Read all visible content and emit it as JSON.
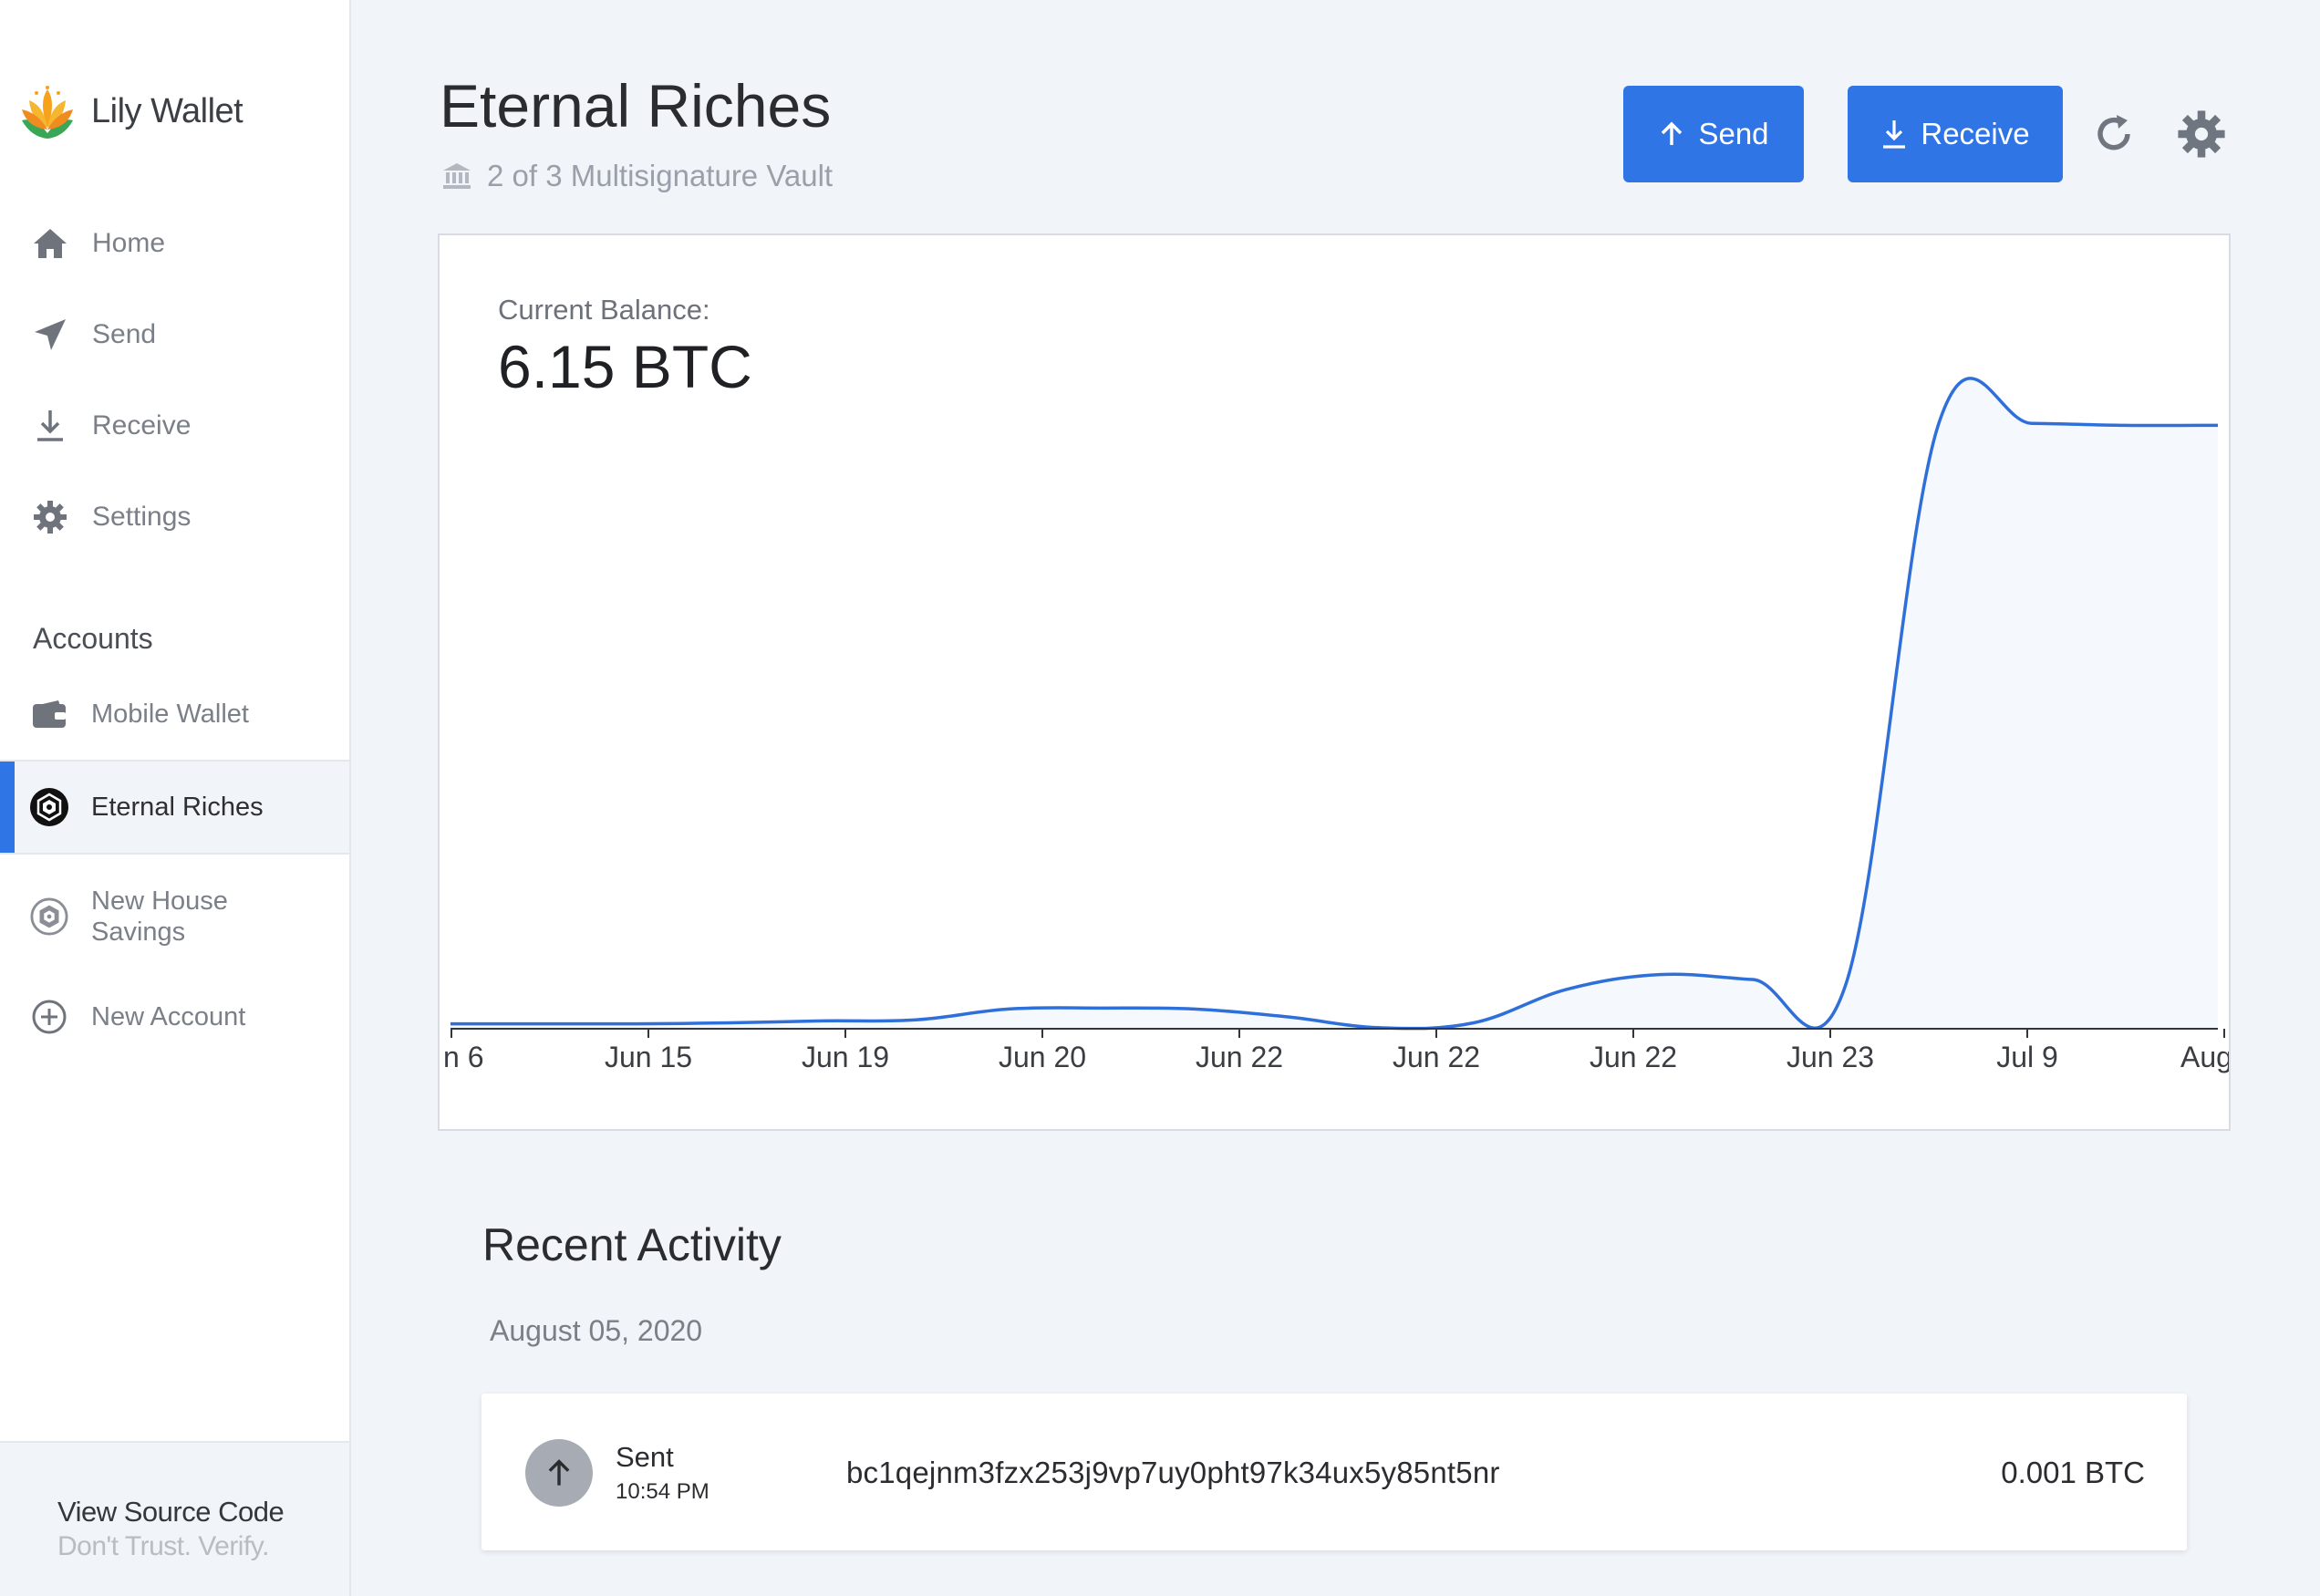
{
  "app": {
    "name": "Lily Wallet"
  },
  "colors": {
    "accent": "#2f75e6",
    "line": "#2f6fd9",
    "sidebar_bg": "#ffffff",
    "main_bg": "#f1f4f8"
  },
  "nav": [
    {
      "label": "Home",
      "icon": "home-icon"
    },
    {
      "label": "Send",
      "icon": "paper-plane-icon"
    },
    {
      "label": "Receive",
      "icon": "download-icon"
    },
    {
      "label": "Settings",
      "icon": "gear-icon"
    }
  ],
  "accounts": {
    "heading": "Accounts",
    "items": [
      {
        "label": "Mobile Wallet",
        "icon": "wallet-icon",
        "active": false
      },
      {
        "label": "Eternal Riches",
        "icon": "vault-icon",
        "active": true
      },
      {
        "label": "New House Savings",
        "icon": "vault-icon",
        "active": false
      },
      {
        "label": "New Account",
        "icon": "plus-circle-icon",
        "active": false
      }
    ]
  },
  "footer": {
    "link": "View Source Code",
    "tagline": "Don't Trust. Verify."
  },
  "header": {
    "title": "Eternal Riches",
    "subtitle": "2 of 3 Multisignature Vault",
    "send_label": "Send",
    "receive_label": "Receive"
  },
  "balance": {
    "label": "Current Balance:",
    "value": "6.15 BTC"
  },
  "chart_data": {
    "type": "area",
    "x": [
      "n 6",
      "Jun 15",
      "Jun 19",
      "Jun 20",
      "Jun 22",
      "Jun 22",
      "Jun 22",
      "Jun 23",
      "Jul 9",
      "Aug"
    ],
    "series": [
      {
        "values": [
          0.05,
          0.05,
          0.05,
          0.06,
          0.08,
          0.09,
          0.2,
          0.21,
          0.2,
          0.12,
          0.01,
          0.06,
          0.4,
          0.55,
          0.5,
          0.45,
          6.15,
          6.15,
          6.13,
          6.13
        ]
      }
    ],
    "ylim": [
      0,
      6.3
    ],
    "grid": false,
    "legend": "none"
  },
  "activity": {
    "title": "Recent Activity",
    "groups": [
      {
        "date": "August 05, 2020",
        "transactions": [
          {
            "type": "Sent",
            "time": "10:54 PM",
            "address": "bc1qejnm3fzx253j9vp7uy0pht97k34ux5y85nt5nr",
            "amount": "0.001 BTC",
            "icon": "arrow-up-icon"
          }
        ]
      }
    ]
  }
}
